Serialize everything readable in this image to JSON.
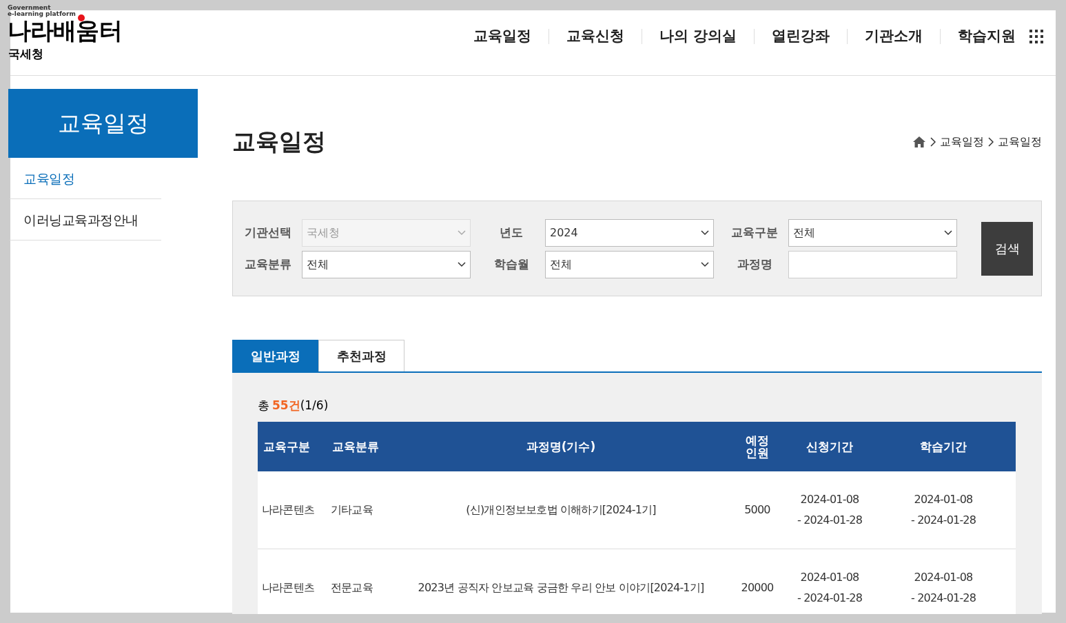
{
  "header": {
    "logo_tagline": "Government\ne-learning platform",
    "logo_text": "나라배움터",
    "agency": "국세청",
    "nav": [
      "교육일정",
      "교육신청",
      "나의 강의실",
      "열린강좌",
      "기관소개",
      "학습지원"
    ]
  },
  "sidebar": {
    "title": "교육일정",
    "items": [
      {
        "label": "교육일정",
        "selected": true
      },
      {
        "label": "이러닝교육과정안내",
        "selected": false
      }
    ]
  },
  "page_title": "교육일정",
  "breadcrumb": [
    "교육일정",
    "교육일정"
  ],
  "search": {
    "fields": [
      {
        "label": "기관선택",
        "kind": "select",
        "value": "국세청",
        "disabled": true
      },
      {
        "label": "년도",
        "kind": "select",
        "value": "2024"
      },
      {
        "label": "교육구분",
        "kind": "select",
        "value": "전체"
      },
      {
        "label": "교육분류",
        "kind": "select",
        "value": "전체"
      },
      {
        "label": "학습월",
        "kind": "select",
        "value": "전체"
      },
      {
        "label": "과정명",
        "kind": "text"
      }
    ],
    "button": "검색"
  },
  "tabs": [
    {
      "label": "일반과정",
      "selected": true
    },
    {
      "label": "추천과정",
      "selected": false
    }
  ],
  "summary": {
    "prefix": "총",
    "count": "55건",
    "page": "(1/6)"
  },
  "table": {
    "columns": [
      "교육구분",
      "교육분류",
      "과정명(기수)",
      "예정인원",
      "신청기간",
      "학습기간"
    ],
    "rows": [
      [
        "나라콘텐츠",
        "기타교육",
        "(신)개인정보보호법 이해하기[2024-1기]",
        "5000",
        "2024-01-08\n- 2024-01-28",
        "2024-01-08\n- 2024-01-28"
      ],
      [
        "나라콘텐츠",
        "전문교육",
        "2023년 공직자 안보교육 궁금한 우리 안보 이야기[2024-1기]",
        "20000",
        "2024-01-08\n- 2024-01-28",
        "2024-01-08\n- 2024-01-28"
      ]
    ]
  }
}
